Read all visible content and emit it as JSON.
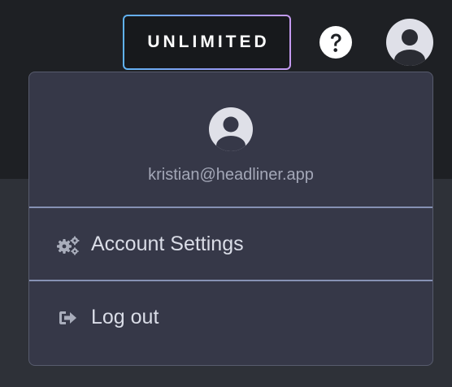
{
  "header": {
    "plan_badge": "UNLIMITED",
    "help_icon": "help-circle-icon",
    "avatar_icon": "user-avatar-icon"
  },
  "account_menu": {
    "avatar_icon": "user-avatar-icon",
    "email": "kristian@headliner.app",
    "items": [
      {
        "label": "Account Settings",
        "icon": "gears-icon"
      },
      {
        "label": "Log out",
        "icon": "sign-out-icon"
      }
    ]
  },
  "colors": {
    "topbar_bg": "#1e2024",
    "page_bg": "#2e3138",
    "menu_bg": "#363848",
    "divider": "#8691b3",
    "badge_gradient_start": "#5fb2f2",
    "badge_gradient_end": "#c59af0"
  }
}
